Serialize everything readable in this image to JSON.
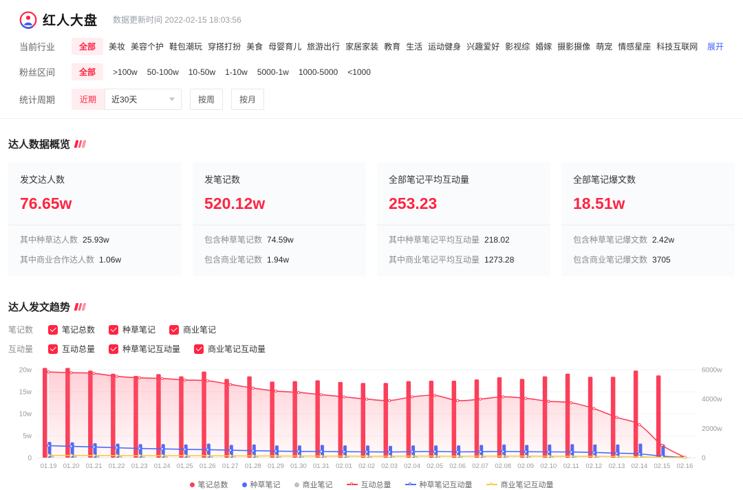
{
  "header": {
    "title": "红人大盘",
    "update_label": "数据更新时间 2022-02-15 18:03:56"
  },
  "filters": {
    "industry": {
      "label": "当前行业",
      "selected": "全部",
      "options": [
        "全部",
        "美妆",
        "美容个护",
        "鞋包潮玩",
        "穿搭打扮",
        "美食",
        "母婴育儿",
        "旅游出行",
        "家居家装",
        "教育",
        "生活",
        "运动健身",
        "兴趣爱好",
        "影视综",
        "婚嫁",
        "摄影摄像",
        "萌宠",
        "情感星座",
        "科技互联网"
      ],
      "expand_label": "展开"
    },
    "fans": {
      "label": "粉丝区间",
      "selected": "全部",
      "options": [
        "全部",
        ">100w",
        "50-100w",
        "10-50w",
        "1-10w",
        "5000-1w",
        "1000-5000",
        "<1000"
      ]
    },
    "period": {
      "label": "统计周期",
      "recent_label": "近期",
      "range_value": "近30天",
      "week_label": "按周",
      "month_label": "按月"
    }
  },
  "overview": {
    "title": "达人数据概览",
    "cards": [
      {
        "title": "发文达人数",
        "value": "76.65w",
        "sub": [
          {
            "label": "其中种草达人数",
            "value": "25.93w"
          },
          {
            "label": "其中商业合作达人数",
            "value": "1.06w"
          }
        ]
      },
      {
        "title": "发笔记数",
        "value": "520.12w",
        "sub": [
          {
            "label": "包含种草笔记数",
            "value": "74.59w"
          },
          {
            "label": "包含商业笔记数",
            "value": "1.94w"
          }
        ]
      },
      {
        "title": "全部笔记平均互动量",
        "value": "253.23",
        "sub": [
          {
            "label": "其中种草笔记平均互动量",
            "value": "218.02"
          },
          {
            "label": "其中商业笔记平均互动量",
            "value": "1273.28"
          }
        ]
      },
      {
        "title": "全部笔记爆文数",
        "value": "18.51w",
        "sub": [
          {
            "label": "包含种草笔记爆文数",
            "value": "2.42w"
          },
          {
            "label": "包含商业笔记爆文数",
            "value": "3705"
          }
        ]
      }
    ]
  },
  "trend": {
    "title": "达人发文趋势",
    "note_row_label": "笔记数",
    "engage_row_label": "互动量",
    "note_checkboxes": [
      "笔记总数",
      "种草笔记",
      "商业笔记"
    ],
    "engage_checkboxes": [
      "互动总量",
      "种草笔记互动量",
      "商业笔记互动量"
    ]
  },
  "colors": {
    "brand_red": "#ff2442",
    "link_blue": "#3e63ff",
    "bar_red": "#fb3e59",
    "bar_blue": "#4a6bfb",
    "bar_gray": "#bcc0c8",
    "line_yellow": "#f7c948",
    "tag_bg": "#ffedf0",
    "card_bg": "#fafbfc"
  },
  "chart_data": {
    "type": "bar+line",
    "categories": [
      "01.19",
      "01.20",
      "01.21",
      "01.22",
      "01.23",
      "01.24",
      "01.25",
      "01.26",
      "01.27",
      "01.28",
      "01.29",
      "01.30",
      "01.31",
      "02.01",
      "02.02",
      "02.03",
      "02.04",
      "02.05",
      "02.06",
      "02.07",
      "02.08",
      "02.09",
      "02.10",
      "02.11",
      "02.12",
      "02.13",
      "02.14",
      "02.15",
      "02.16"
    ],
    "left_axis": {
      "unit": "w",
      "ticks": [
        "0",
        "5w",
        "10w",
        "15w",
        "20w"
      ],
      "max": 20
    },
    "right_axis": {
      "unit": "w",
      "ticks": [
        "0",
        "2000w",
        "4000w",
        "6000w"
      ],
      "max": 6000
    },
    "bar_series": [
      {
        "name": "笔记总数",
        "axis": "left",
        "color": "#fb3e59",
        "values": [
          20.4,
          20.4,
          19.8,
          19.1,
          18.6,
          19.0,
          18.5,
          19.6,
          17.9,
          18.5,
          17.3,
          17.4,
          17.6,
          17.2,
          17.0,
          17.0,
          17.4,
          17.5,
          17.5,
          17.8,
          18.3,
          17.9,
          18.5,
          19.1,
          18.4,
          18.4,
          19.8,
          18.7,
          0.3
        ]
      },
      {
        "name": "种草笔记",
        "axis": "left",
        "color": "#4a6bfb",
        "values": [
          3.6,
          3.5,
          3.3,
          3.2,
          3.1,
          3.1,
          3.0,
          3.2,
          2.9,
          3.0,
          2.8,
          2.8,
          2.9,
          2.8,
          2.8,
          2.7,
          2.8,
          2.8,
          2.8,
          2.9,
          3.0,
          2.9,
          3.0,
          3.1,
          3.0,
          3.0,
          3.2,
          3.0,
          0.1
        ]
      },
      {
        "name": "商业笔记",
        "axis": "left",
        "color": "#bcc0c8",
        "values": [
          0.45,
          0.45,
          0.4,
          0.4,
          0.35,
          0.35,
          0.35,
          0.35,
          0.3,
          0.3,
          0.3,
          0.3,
          0.3,
          0.3,
          0.3,
          0.3,
          0.3,
          0.3,
          0.3,
          0.3,
          0.35,
          0.3,
          0.35,
          0.35,
          0.3,
          0.3,
          0.35,
          0.3,
          0.02
        ]
      }
    ],
    "line_series": [
      {
        "name": "互动总量",
        "axis": "right",
        "color": "#fb3e59",
        "area": true,
        "values": [
          5850,
          5800,
          5750,
          5550,
          5450,
          5400,
          5300,
          5250,
          5000,
          4750,
          4550,
          4450,
          4300,
          4150,
          4000,
          3900,
          4150,
          4250,
          3900,
          4000,
          4150,
          4050,
          3850,
          3750,
          3350,
          2750,
          2250,
          850,
          30
        ]
      },
      {
        "name": "种草笔记互动量",
        "axis": "right",
        "color": "#4a6bfb",
        "values": [
          820,
          780,
          730,
          680,
          630,
          600,
          570,
          550,
          510,
          480,
          450,
          430,
          420,
          410,
          400,
          390,
          410,
          420,
          400,
          410,
          420,
          410,
          400,
          390,
          360,
          310,
          260,
          110,
          10
        ]
      },
      {
        "name": "商业笔记互动量",
        "axis": "right",
        "color": "#f7c948",
        "values": [
          160,
          155,
          150,
          145,
          140,
          135,
          135,
          130,
          125,
          120,
          115,
          115,
          110,
          110,
          105,
          105,
          110,
          110,
          105,
          110,
          110,
          110,
          105,
          100,
          95,
          80,
          60,
          25,
          5
        ]
      }
    ],
    "legend": [
      {
        "label": "笔记总数",
        "type": "bar",
        "color": "#fb3e59"
      },
      {
        "label": "种草笔记",
        "type": "bar",
        "color": "#4a6bfb"
      },
      {
        "label": "商业笔记",
        "type": "bar",
        "color": "#bcc0c8"
      },
      {
        "label": "互动总量",
        "type": "line",
        "color": "#fb3e59"
      },
      {
        "label": "种草笔记互动量",
        "type": "line",
        "color": "#4a6bfb"
      },
      {
        "label": "商业笔记互动量",
        "type": "line",
        "color": "#f7c948"
      }
    ]
  }
}
